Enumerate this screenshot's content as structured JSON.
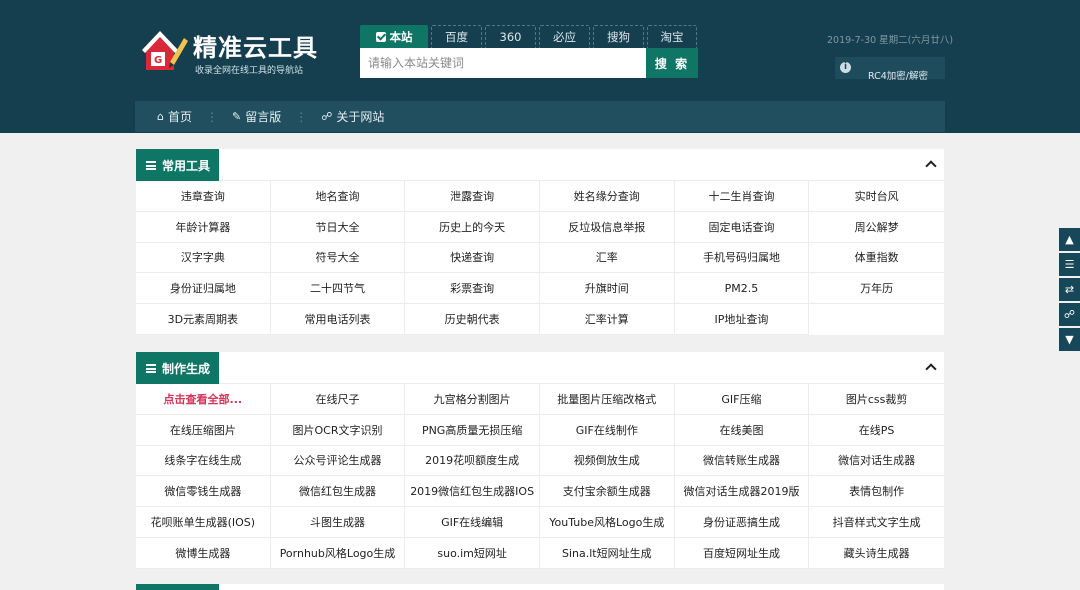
{
  "site": {
    "title": "精准云工具",
    "subtitle": "收录全网在线工具的导航站"
  },
  "search": {
    "engines": [
      "本站",
      "百度",
      "360",
      "必应",
      "搜狗",
      "淘宝"
    ],
    "active_engine": "本站",
    "placeholder": "请输入本站关键词",
    "button_label": "搜 索"
  },
  "header_info": {
    "date": "2019-7-30 星期二(六月廿八)",
    "info_label": "RC4加密/解密"
  },
  "nav": {
    "items": [
      {
        "label": "首页",
        "icon": "home-icon"
      },
      {
        "label": "留言版",
        "icon": "edit-icon"
      },
      {
        "label": "关于网站",
        "icon": "link-icon"
      }
    ]
  },
  "sections": [
    {
      "title": "常用工具",
      "items": [
        "违章查询",
        "地名查询",
        "泄露查询",
        "姓名缘分查询",
        "十二生肖查询",
        "实时台风",
        "年龄计算器",
        "节日大全",
        "历史上的今天",
        "反垃圾信息举报",
        "固定电话查询",
        "周公解梦",
        "汉字字典",
        "符号大全",
        "快递查询",
        "汇率",
        "手机号码归属地",
        "体重指数",
        "身份证归属地",
        "二十四节气",
        "彩票查询",
        "升旗时间",
        "PM2.5",
        "万年历",
        "3D元素周期表",
        "常用电话列表",
        "历史朝代表",
        "汇率计算",
        "IP地址查询"
      ]
    },
    {
      "title": "制作生成",
      "items": [
        "点击查看全部...",
        "在线尺子",
        "九宫格分割图片",
        "批量图片压缩改格式",
        "GIF压缩",
        "图片css裁剪",
        "在线压缩图片",
        "图片OCR文字识别",
        "PNG高质量无损压缩",
        "GIF在线制作",
        "在线美图",
        "在线PS",
        "线条字在线生成",
        "公众号评论生成器",
        "2019花呗额度生成",
        "视频倒放生成",
        "微信转账生成器",
        "微信对话生成器",
        "微信零钱生成器",
        "微信红包生成器",
        "2019微信红包生成器IOS",
        "支付宝余额生成器",
        "微信对话生成器2019版",
        "表情包制作",
        "花呗账单生成器(IOS)",
        "斗图生成器",
        "GIF在线编辑",
        "YouTube风格Logo生成",
        "身份证恶搞生成",
        "抖音样式文字生成",
        "微博生成器",
        "Pornhub风格Logo生成",
        "suo.im短网址",
        "Sina.lt短网址生成",
        "百度短网址生成",
        "藏头诗生成器"
      ]
    }
  ],
  "side_tools": [
    "top-icon",
    "list-icon",
    "shuffle-icon",
    "share-icon",
    "down-icon"
  ],
  "colors": {
    "header_bg": "#153f4f",
    "accent": "#0f7666",
    "highlight_text": "#d4335a"
  }
}
